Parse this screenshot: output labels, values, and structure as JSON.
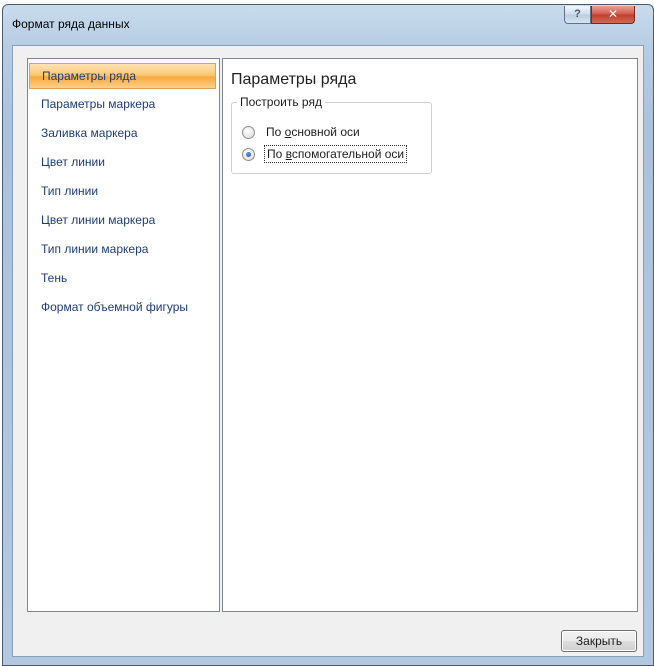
{
  "window": {
    "title": "Формат ряда данных",
    "help_button": "?",
    "close_button": "✕"
  },
  "sidebar": {
    "items": [
      {
        "label": "Параметры ряда",
        "active": true
      },
      {
        "label": "Параметры маркера",
        "active": false
      },
      {
        "label": "Заливка маркера",
        "active": false
      },
      {
        "label": "Цвет линии",
        "active": false
      },
      {
        "label": "Тип линии",
        "active": false
      },
      {
        "label": "Цвет линии маркера",
        "active": false
      },
      {
        "label": "Тип линии маркера",
        "active": false
      },
      {
        "label": "Тень",
        "active": false
      },
      {
        "label": "Формат объемной фигуры",
        "active": false
      }
    ]
  },
  "main": {
    "title": "Параметры ряда",
    "group": {
      "label": "Построить ряд",
      "options": [
        {
          "prefix": "По ",
          "underlined": "о",
          "rest": "сновной оси",
          "checked": false
        },
        {
          "prefix": "По ",
          "underlined": "в",
          "rest": "спомогательной оси",
          "checked": true
        }
      ]
    }
  },
  "footer": {
    "close_label": "Закрыть"
  }
}
